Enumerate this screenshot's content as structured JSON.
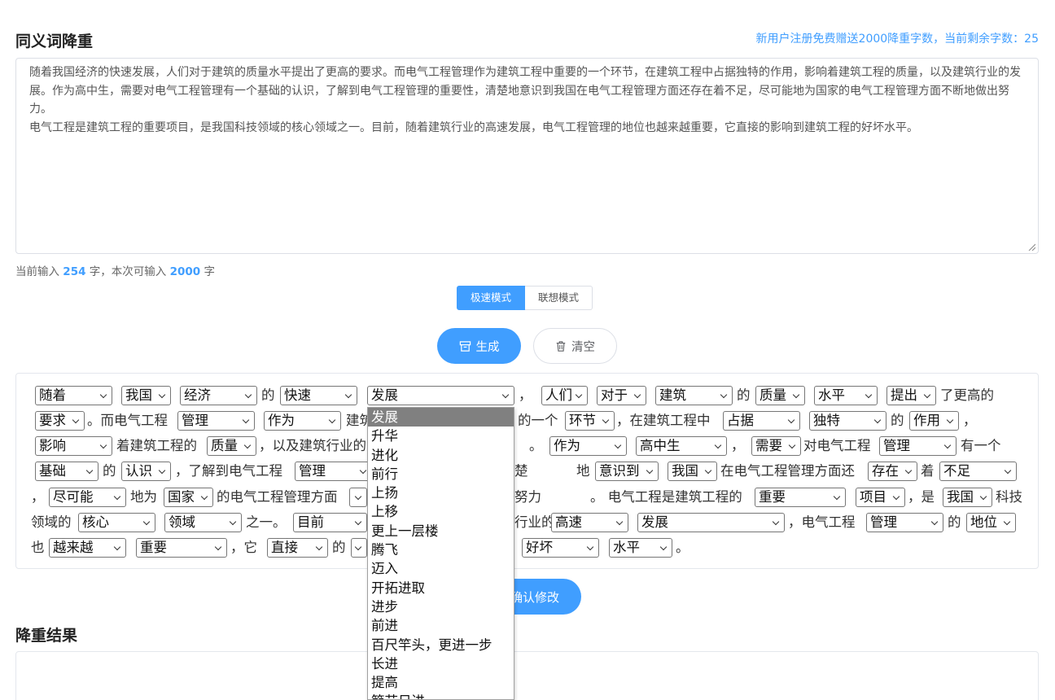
{
  "header": {
    "title": "同义词降重",
    "promo": "新用户注册免费赠送2000降重字数，当前剩余字数：25"
  },
  "input": {
    "paragraphs": [
      "随着我国经济的快速发展，人们对于建筑的质量水平提出了更高的要求。而电气工程管理作为建筑工程中重要的一个环节，在建筑工程中占据独特的作用，影响着建筑工程的质量，以及建筑行业的发展。作为高中生，需要对电气工程管理有一个基础的认识，了解到电气工程管理的重要性，清楚地意识到我国在电气工程管理方面还存在着不足，尽可能地为国家的电气工程管理方面不断地做出努力。",
      "电气工程是建筑工程的重要项目，是我国科技领域的核心领域之一。目前，随着建筑行业的高速发展，电气工程管理的地位也越来越重要，它直接的影响到建筑工程的好坏水平。"
    ]
  },
  "count": {
    "prefix": "当前输入",
    "current": "254",
    "middle": "字，本次可输入",
    "max": "2000",
    "suffix": "字"
  },
  "modes": {
    "fast": "极速模式",
    "assoc": "联想模式"
  },
  "buttons": {
    "generate": "生成",
    "clear": "清空",
    "confirm": "确认修改"
  },
  "editor": {
    "selects": [
      "随着",
      "我国",
      "经济",
      "快速",
      "发展",
      "人们",
      "对于",
      "建筑",
      "质量",
      "水平",
      "提出",
      "要求",
      "管理",
      "作为",
      "环节",
      "占据",
      "独特",
      "作用",
      "影响",
      "质量",
      "作为",
      "高中生",
      "需要",
      "管理",
      "基础",
      "认识",
      "管理",
      "意识到",
      "我国",
      "存在",
      "不足",
      "尽可能",
      "国家",
      "重要",
      "项目",
      "我国",
      "核心",
      "领域",
      "目前",
      "高速",
      "发展",
      "管理",
      "地位",
      "越来越",
      "重要",
      "直接",
      "好坏",
      "水平"
    ],
    "texts": [
      "的",
      "，",
      "的",
      "了更高的",
      "。而电气工程",
      "建筑",
      "的一个",
      "，在建筑工程中",
      "的",
      "，",
      "着建筑工程的",
      "，以及建筑行业的",
      "。",
      "，",
      "对电气工程",
      "有一个",
      "的",
      "，了解到电气工程",
      "楚",
      "地",
      "在电气工程管理方面还",
      "着",
      "，",
      "地为",
      "的电气工程管理方面",
      "努力",
      "。 电气工程是建筑工程的",
      "，是",
      "科技",
      "领域的",
      "之一。",
      "行业的",
      "，电气工程",
      "的",
      "也",
      "，它",
      "的",
      "。"
    ]
  },
  "dropdown": {
    "options": [
      "发展",
      "升华",
      "进化",
      "前行",
      "上扬",
      "上移",
      "更上一层楼",
      "腾飞",
      "迈入",
      "开拓进取",
      "进步",
      "前进",
      "百尺竿头，更进一步",
      "长进",
      "提高",
      "節节日进"
    ]
  },
  "result": {
    "title": "降重结果"
  }
}
